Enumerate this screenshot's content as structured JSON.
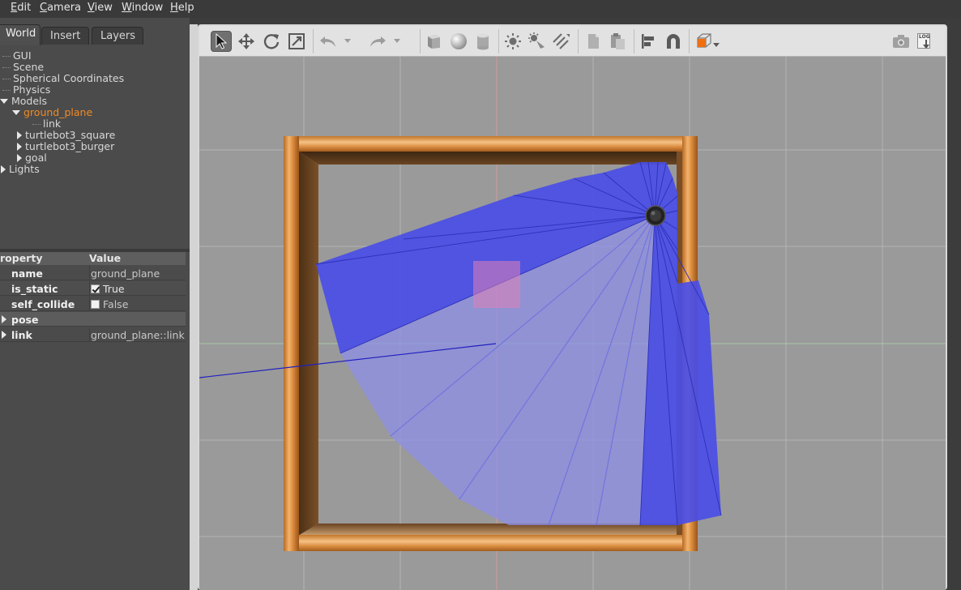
{
  "menu": [
    "Edit",
    "Camera",
    "View",
    "Window",
    "Help"
  ],
  "tabs": {
    "world": "World",
    "insert": "Insert",
    "layers": "Layers"
  },
  "tree": {
    "gui": "GUI",
    "scene": "Scene",
    "spherical": "Spherical Coordinates",
    "physics": "Physics",
    "models": "Models",
    "ground_plane": "ground_plane",
    "link": "link",
    "turtlebot3_square": "turtlebot3_square",
    "turtlebot3_burger": "turtlebot3_burger",
    "goal": "goal",
    "lights": "Lights"
  },
  "properties": {
    "header_property": "roperty",
    "header_value": "Value",
    "rows": [
      {
        "key": "name",
        "value": "ground_plane"
      },
      {
        "key": "is_static",
        "value": "True",
        "checked": true
      },
      {
        "key": "self_collide",
        "value": "False",
        "checked": false
      },
      {
        "key": "pose",
        "value": ""
      },
      {
        "key": "link",
        "value": "ground_plane::link"
      }
    ]
  },
  "toolbar": {
    "icons": [
      "select-arrow-icon",
      "translate-icon",
      "rotate-icon",
      "scale-icon",
      "undo-icon",
      "redo-icon",
      "box-icon",
      "sphere-icon",
      "cylinder-icon",
      "point-light-icon",
      "spot-light-icon",
      "directional-light-icon",
      "copy-icon",
      "paste-icon",
      "align-icon",
      "magnet-icon",
      "view-angle-icon",
      "screenshot-icon",
      "log-icon"
    ],
    "log_label": "LOG"
  },
  "colors": {
    "scene_bg": "#9a9a9a",
    "grid": "#b4b4b4",
    "laser_dark": "#4a4ee6",
    "laser_light": "#8e8fe6",
    "wall_wood": "#d88a3a",
    "goal": "#e07fb8",
    "selected_text": "#f08a24"
  }
}
